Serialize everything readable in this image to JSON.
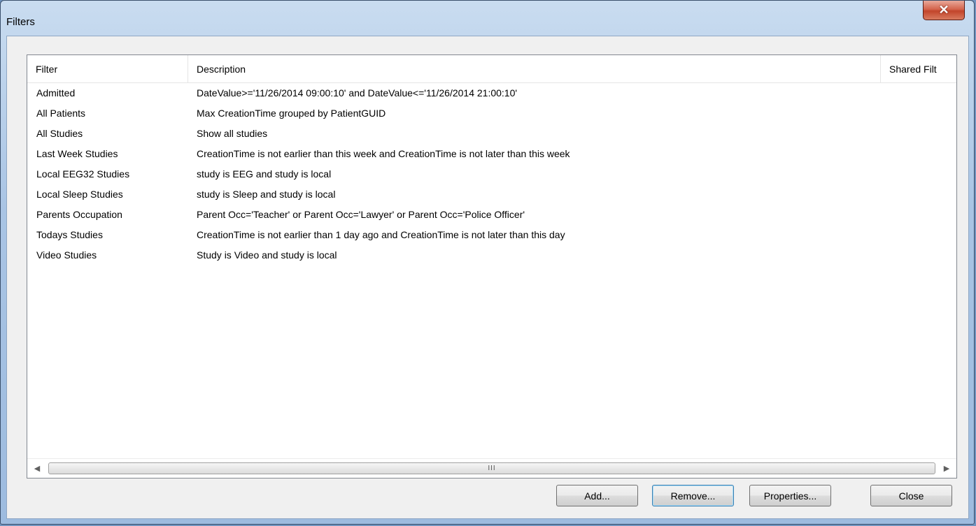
{
  "window": {
    "title": "Filters",
    "close_glyph": "✕"
  },
  "list": {
    "columns": [
      "Filter",
      "Description",
      "Shared Filt"
    ],
    "rows": [
      {
        "filter": "Admitted",
        "description": "DateValue>='11/26/2014 09:00:10' and DateValue<='11/26/2014 21:00:10'"
      },
      {
        "filter": "All Patients",
        "description": "Max CreationTime grouped by PatientGUID"
      },
      {
        "filter": "All Studies",
        "description": "Show all studies"
      },
      {
        "filter": "Last Week Studies",
        "description": "CreationTime is not earlier than this week and CreationTime is not later than this week"
      },
      {
        "filter": "Local EEG32 Studies",
        "description": "study is EEG and study is local"
      },
      {
        "filter": "Local Sleep Studies",
        "description": "study is Sleep and study is local"
      },
      {
        "filter": "Parents Occupation",
        "description": "Parent Occ='Teacher' or Parent Occ='Lawyer' or Parent Occ='Police Officer'"
      },
      {
        "filter": "Todays Studies",
        "description": "CreationTime is not earlier than 1 day ago and CreationTime is not later than this day"
      },
      {
        "filter": "Video Studies",
        "description": "Study is Video and study is local"
      }
    ]
  },
  "scrollbar": {
    "left_arrow": "◀",
    "right_arrow": "▶",
    "grip": "III"
  },
  "buttons": {
    "add": "Add...",
    "remove": "Remove...",
    "properties": "Properties...",
    "close": "Close"
  }
}
